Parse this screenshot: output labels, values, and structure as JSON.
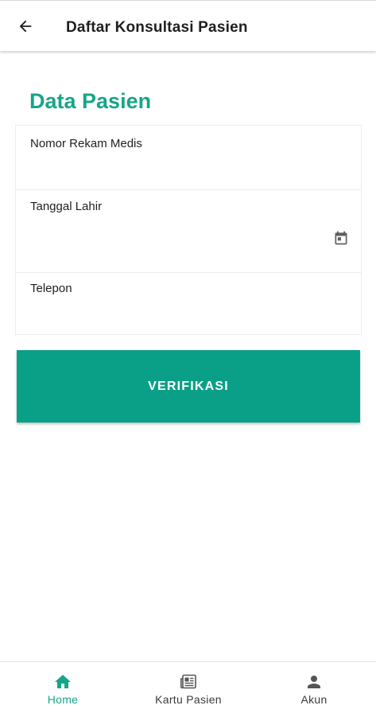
{
  "appbar": {
    "title": "Daftar Konsultasi Pasien",
    "back_icon": "arrow-left-icon"
  },
  "form": {
    "section_title": "Data Pasien",
    "fields": [
      {
        "label": "Nomor Rekam Medis",
        "value": "",
        "placeholder": ""
      },
      {
        "label": "Tanggal Lahir",
        "value": "",
        "placeholder": "",
        "icon": "calendar-icon"
      },
      {
        "label": "Telepon",
        "value": "",
        "placeholder": ""
      }
    ],
    "submit_label": "VERIFIKASI"
  },
  "bottom_nav": {
    "items": [
      {
        "label": "Home",
        "icon": "home-icon",
        "active": true
      },
      {
        "label": "Kartu Pasien",
        "icon": "newspaper-icon",
        "active": false
      },
      {
        "label": "Akun",
        "icon": "person-icon",
        "active": false
      }
    ]
  },
  "colors": {
    "accent": "#17a589",
    "button": "#0aa088",
    "inactive_icon": "#555555",
    "inactive_label": "#3a3a3a"
  }
}
